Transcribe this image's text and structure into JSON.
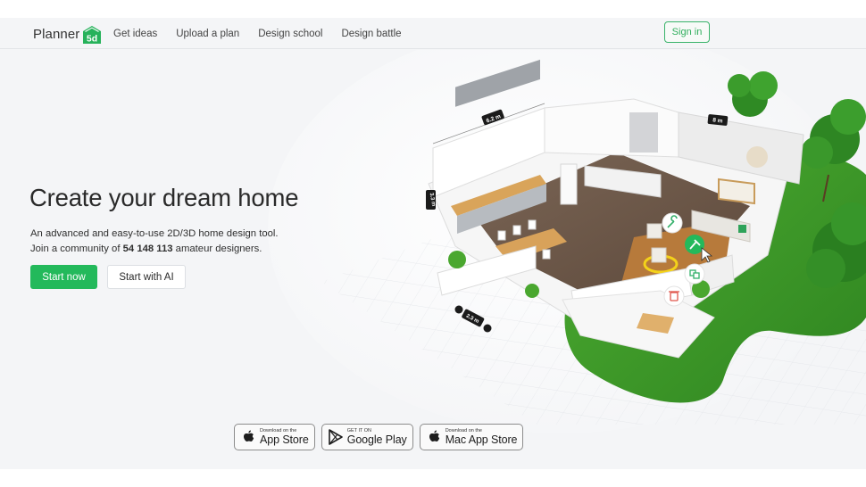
{
  "nav": {
    "logo": {
      "text": "Planner",
      "badge": "5d"
    },
    "links": [
      {
        "label": "Get ideas"
      },
      {
        "label": "Upload a plan"
      },
      {
        "label": "Design school"
      },
      {
        "label": "Design battle"
      }
    ],
    "sign_in": "Sign in"
  },
  "hero": {
    "title": "Create your dream home",
    "description_line1": "An advanced and easy-to-use 2D/3D home design tool.",
    "description_line2_prefix": "Join a community of ",
    "community_count": "54 148 113",
    "description_line2_suffix": " amateur designers.",
    "primary_button": "Start now",
    "secondary_button": "Start with AI"
  },
  "illustration": {
    "dimension_labels": {
      "top_left": "6.2 m",
      "left": "3.3 m",
      "top_right": "8 m",
      "bottom": "2.3 m"
    },
    "tool_icons": [
      "wrench-icon",
      "paint-brush-icon",
      "copy-icon",
      "trash-icon"
    ]
  },
  "stores": [
    {
      "small": "Download on the",
      "big": "App Store",
      "icon": "apple-icon"
    },
    {
      "small": "GET IT ON",
      "big": "Google Play",
      "icon": "google-play-icon"
    },
    {
      "small": "Download on the",
      "big": "Mac App Store",
      "icon": "apple-icon"
    }
  ],
  "colors": {
    "brand_green": "#23b95b",
    "background": "#f4f5f7",
    "lawn": "#3f9a2b"
  }
}
